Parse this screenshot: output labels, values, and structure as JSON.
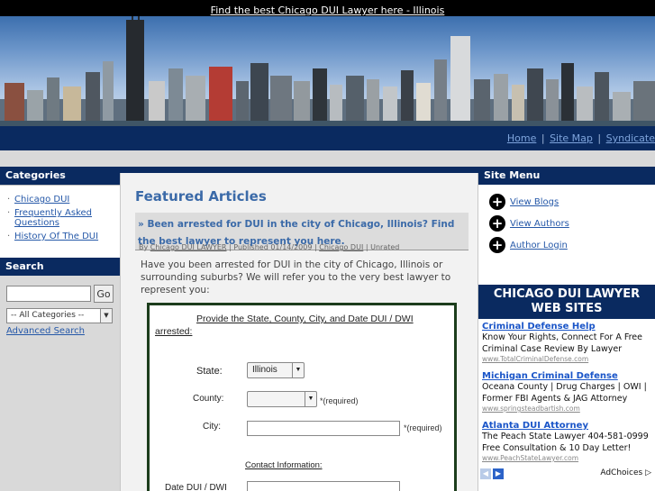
{
  "topbar": {
    "link": "Find the best Chicago DUI Lawyer here - Illinois"
  },
  "nav": {
    "home": "Home",
    "sitemap": "Site Map",
    "syndicate": "Syndicate",
    "sep": "|"
  },
  "categories": {
    "title": "Categories",
    "items": [
      {
        "label": "Chicago DUI"
      },
      {
        "label": "Frequently Asked Questions"
      },
      {
        "label": "History Of The DUI"
      }
    ]
  },
  "search": {
    "title": "Search",
    "go": "Go",
    "category_selected": "-- All Categories --",
    "advanced": "Advanced Search"
  },
  "main": {
    "featured_title": "Featured Articles",
    "article_title": "» Been arrested for DUI in the city of Chicago, Illinois? Find the best lawyer to represent you here.",
    "byline": {
      "by": "By",
      "author": "Chicago DUI LAWYER",
      "published": "| Published 01/14/2009 |",
      "category": "Chicago DUI",
      "status": "| Unrated"
    },
    "intro": "Have you been arrested for DUI in the city of Chicago, Illinois or surrounding suburbs? We will refer you to the very best lawyer to represent you:"
  },
  "form": {
    "heading": "Provide the State, County, City, and Date DUI / DWI arrested:",
    "state_label": "State:",
    "state_value": "Illinois",
    "county_label": "County:",
    "county_value": "",
    "required": "*(required)",
    "city_label": "City:",
    "city_required": "*(required)",
    "contact_label": "Contact Information:",
    "date_label": "Date DUI / DWI"
  },
  "sitemenu": {
    "title": "Site Menu",
    "items": [
      {
        "label": "View Blogs"
      },
      {
        "label": "View Authors"
      },
      {
        "label": "Author Login"
      }
    ]
  },
  "ads": {
    "header": "CHICAGO DUI LAWYER WEB SITES",
    "items": [
      {
        "title": "Criminal Defense Help",
        "text": "Know Your Rights, Connect For A Free Criminal Case Review By Lawyer",
        "url": "www.TotalCriminalDefense.com"
      },
      {
        "title": "Michigan Criminal Defense",
        "text": "Oceana County | Drug Charges | OWI | Former FBI Agents & JAG Attorney",
        "url": "www.springsteadbartish.com"
      },
      {
        "title": "Atlanta DUI Attorney",
        "text": "The Peach State Lawyer 404-581-0999 Free Consultation & 10 Day Letter!",
        "url": "www.PeachStateLawyer.com"
      }
    ],
    "adchoices": "AdChoices ▷"
  }
}
